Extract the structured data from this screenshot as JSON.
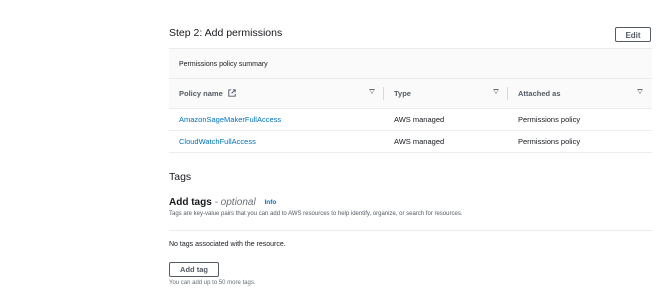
{
  "step": {
    "title": "Step 2: Add permissions",
    "edit_label": "Edit"
  },
  "permissions": {
    "summary_title": "Permissions policy summary",
    "columns": [
      "Policy name",
      "Type",
      "Attached as"
    ],
    "rows": [
      {
        "policy_name": "AmazonSageMakerFullAccess",
        "type": "AWS managed",
        "attached_as": "Permissions policy"
      },
      {
        "policy_name": "CloudWatchFullAccess",
        "type": "AWS managed",
        "attached_as": "Permissions policy"
      }
    ]
  },
  "tags": {
    "section_title": "Tags",
    "add_tags_label": "Add tags",
    "optional_label": "- optional",
    "info_label": "Info",
    "description": "Tags are key-value pairs that you can add to AWS resources to help identify, organize, or search for resources.",
    "empty_message": "No tags associated with the resource.",
    "add_tag_button": "Add tag",
    "limit_text": "You can add up to 50 more tags."
  },
  "colors": {
    "link": "#0073bb",
    "text": "#16191f",
    "muted": "#545b64",
    "header_bg": "#fafafa",
    "border": "#eaeded"
  }
}
